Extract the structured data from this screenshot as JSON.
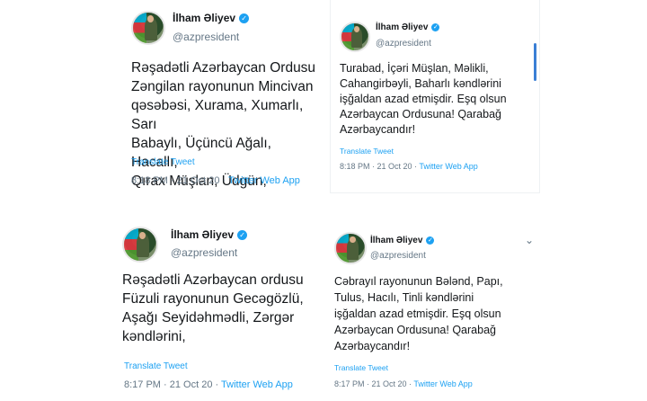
{
  "tweets": [
    {
      "author": "İlham Əliyev",
      "handle": "@azpresident",
      "text": "Rəşadətli Azərbaycan Ordusu\nZəngilan rayonunun Mincivan\nqəsəbəsi, Xurama, Xumarlı, Sarı\nBabaylı, Üçüncü Ağalı, Hacallı,\nQırax Müşlan, Üdgün,",
      "translate": "Translate Tweet",
      "time": "8:18 PM · 21 Oct 20 · ",
      "source": "Twitter Web App",
      "verified_icon": "verified-badge-icon"
    },
    {
      "author": "İlham Əliyev",
      "handle": "@azpresident",
      "text": "Turabad, İçəri Müşlan, Məlikli,\nCahangirbəyli, Baharlı kəndlərini\nişğaldan azad etmişdir. Eşq olsun\nAzərbaycan Ordusuna! Qarabağ\nAzərbaycandır!",
      "translate": "Translate Tweet",
      "time": "8:18 PM · 21 Oct 20 · ",
      "source": "Twitter Web App",
      "verified_icon": "verified-badge-icon"
    },
    {
      "author": "İlham Əliyev",
      "handle": "@azpresident",
      "text": "Rəşadətli Azərbaycan ordusu\nFüzuli rayonunun Gecəgözlü,\nAşağı Seyidəhmədli, Zərgər\nkəndlərini,",
      "translate": "Translate Tweet",
      "time": "8:17 PM · 21 Oct 20 · ",
      "source": "Twitter Web App",
      "verified_icon": "verified-badge-icon"
    },
    {
      "author": "İlham Əliyev",
      "handle": "@azpresident",
      "text": "Cəbrayıl rayonunun Bələnd, Papı,\nTulus, Hacılı, Tinli kəndlərini\nişğaldan azad etmişdir. Eşq olsun\nAzərbaycan Ordusuna! Qarabağ\nAzərbaycandır!",
      "translate": "Translate Tweet",
      "time": "8:17 PM · 21 Oct 20 · ",
      "source": "Twitter Web App",
      "verified_icon": "verified-badge-icon"
    }
  ],
  "colors": {
    "link": "#1da1f2",
    "muted": "#657786",
    "text": "#14171a",
    "border": "#e6ecf0"
  }
}
